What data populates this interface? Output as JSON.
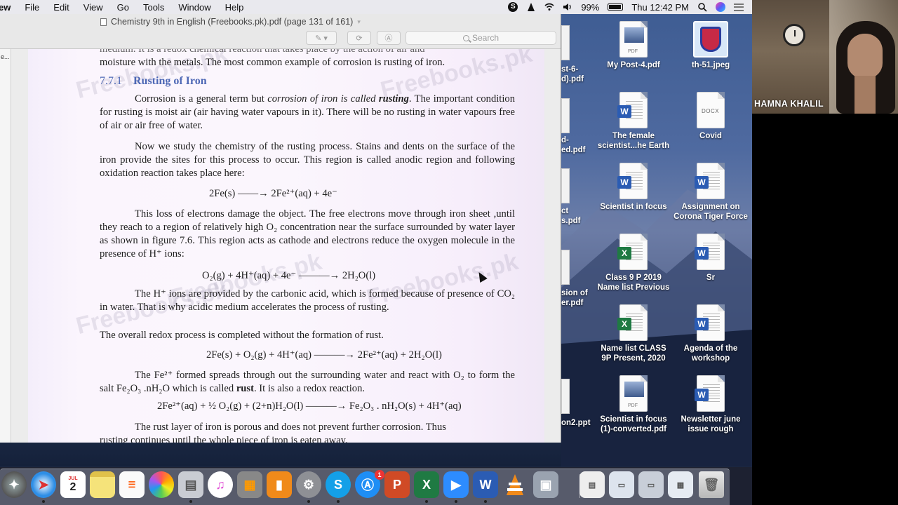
{
  "menubar": {
    "app_name": "ew",
    "items": [
      "File",
      "Edit",
      "View",
      "Go",
      "Tools",
      "Window",
      "Help"
    ],
    "battery": "99%",
    "clock": "Thu 12:42 PM"
  },
  "preview": {
    "window_title": "Chemistry 9th in English (Freebooks.pk).pdf (page 131 of 161)",
    "search_placeholder": "Search",
    "sidebar_text": "e..."
  },
  "page": {
    "cut_top_line1": "medium. It is a redox chemical reaction that takes place by the action of air and",
    "cut_top_line2": "moisture with the metals. The most common example of corrosion is rusting of iron.",
    "heading_number": "7.7.1",
    "heading_title": "Rusting of Iron",
    "para1_a": "Corrosion is a general term but ",
    "para1_em": "corrosion of iron is called ",
    "para1_strong": "rusting",
    "para1_b": ". The important condition for rusting is moist air (air having water vapours in it). There will be no rusting in water vapours free of air or air free of water.",
    "para2": "Now we study the chemistry of the rusting process. Stains and dents on the surface of the iron provide the sites for this process to occur. This region is called anodic region and following oxidation reaction takes place here:",
    "eq1": "2Fe(s)  ——→  2Fe²⁺(aq)    +    4e⁻",
    "para3": "This loss of electrons damage the object. The free electrons move through  iron sheet ,until they reach to a region of relatively high O₂ concentration near the surface surrounded by water layer as shown in figure 7.6. This region acts as cathode and electrons reduce the oxygen molecule in the presence of H⁺ ions:",
    "eq2": "O₂(g)  + 4H⁺(aq) + 4e⁻  ———→  2H₂O(l)",
    "para4": "The H⁺ ions are provided by the carbonic acid, which is formed because of presence of CO₂ in water. That is why acidic medium accelerates the process of rusting.",
    "para5": "The overall redox process is completed without the formation of rust.",
    "eq3": "2Fe(s) + O₂(g) + 4H⁺(aq)  ———→  2Fe²⁺(aq) + 2H₂O(l)",
    "para6_a": "The Fe²⁺ formed spreads through out the surrounding water and react with O₂ to form the salt Fe₂O₃ .nH₂O which is called ",
    "para6_strong": "rust",
    "para6_b": ". It is also a redox reaction.",
    "eq4": "2Fe²⁺(aq) + ½ O₂(g) +  (2+n)H₂O(l)  ———→  Fe₂O₃ . nH₂O(s) + 4H⁺(aq)",
    "para7": "The rust layer of iron is porous and does not  prevent further corrosion. Thus",
    "para8_cut": "rusting continues until the whole piece of iron is eaten away.",
    "watermark": "Freebooks.pk"
  },
  "desktop": {
    "partial_labels": [
      "st-6-",
      "d).pdf",
      "d-",
      "ed.pdf",
      "ct",
      "s.pdf",
      "sion of",
      "er.pdf",
      "on2.ppt"
    ],
    "icons": [
      {
        "label": "My Post-4.pdf",
        "kind": "pdf"
      },
      {
        "label": "th-51.jpeg",
        "kind": "jpeg"
      },
      {
        "label": "The female scientist...he Earth",
        "kind": "word"
      },
      {
        "label": "Covid",
        "kind": "docx"
      },
      {
        "label": "Scientist in focus",
        "kind": "word"
      },
      {
        "label": "Assignment on Corona Tiger Force",
        "kind": "word"
      },
      {
        "label": "Class 9 P 2019 Name list Previous",
        "kind": "excel"
      },
      {
        "label": "Sr",
        "kind": "word"
      },
      {
        "label": "Name list CLASS 9P Present, 2020",
        "kind": "excel"
      },
      {
        "label": "Agenda of the workshop",
        "kind": "word"
      },
      {
        "label": "Scientist in focus (1)-converted.pdf",
        "kind": "pdf"
      },
      {
        "label": "Newsletter june issue rough",
        "kind": "word"
      }
    ],
    "file_tags": {
      "pdf": "PDF",
      "docx": "DOCX",
      "word": "W",
      "excel": "X"
    }
  },
  "video": {
    "participant_name": "HAMNA KHALIL"
  },
  "dock": {
    "calendar_month": "JUL",
    "calendar_day": "2",
    "apps": [
      "launchpad",
      "safari",
      "calendar",
      "notes",
      "reminders",
      "photos",
      "preview-app",
      "itunes",
      "calculator",
      "ibooks",
      "system-preferences",
      "skype",
      "app-store",
      "powerpoint",
      "excel",
      "zoom",
      "word",
      "vlc",
      "image-capture"
    ],
    "app_letters": {
      "skype": "S",
      "powerpoint": "P",
      "excel": "X",
      "word": "W"
    },
    "app_store_badge": "1"
  }
}
